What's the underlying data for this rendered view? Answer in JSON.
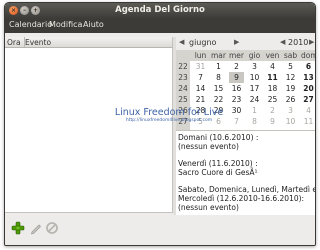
{
  "window": {
    "title": "Agenda Del Giorno"
  },
  "menu": {
    "items": [
      "Calendario",
      "Modifica",
      "Aiuto"
    ]
  },
  "event_list": {
    "columns": [
      "Ora",
      "Evento"
    ]
  },
  "calendar": {
    "month_label": "giugno",
    "year_label": "2010",
    "nav": {
      "prev": "◀",
      "next": "▶"
    },
    "weekdays": [
      "lun",
      "mar",
      "mer",
      "gio",
      "ven",
      "sab",
      "dom"
    ],
    "weeks": [
      {
        "num": "22",
        "days": [
          "31",
          "1",
          "2",
          "3",
          "4",
          "5",
          "6"
        ]
      },
      {
        "num": "23",
        "days": [
          "7",
          "8",
          "9",
          "10",
          "11",
          "12",
          "13"
        ]
      },
      {
        "num": "24",
        "days": [
          "14",
          "15",
          "16",
          "17",
          "18",
          "19",
          "20"
        ]
      },
      {
        "num": "25",
        "days": [
          "21",
          "22",
          "23",
          "24",
          "25",
          "26",
          "27"
        ]
      },
      {
        "num": "26",
        "days": [
          "28",
          "29",
          "30",
          "1",
          "2",
          "3",
          "4"
        ]
      },
      {
        "num": "27",
        "days": [
          "5",
          "6",
          "7",
          "8",
          "9",
          "10",
          "11"
        ]
      }
    ],
    "today": "9"
  },
  "details": {
    "entries": [
      "Domani (10.6.2010) :\n(nessun evento)",
      "Venerdì (11.6.2010) :\nSacro Cuore di GesÃ¹",
      "Sabato, Domenica, Lunedì, Martedì e\nMercoledì (12.6.2010-16.6.2010):\n(nessun evento)"
    ]
  },
  "watermark": {
    "title": "Linux Freedom for Live",
    "url": "http://linuxfreedom4live.blogspot.com"
  },
  "toolbar": {
    "icons": [
      "add-icon",
      "edit-icon",
      "delete-icon"
    ]
  },
  "colors": {
    "titlebar": "#3d3c38",
    "menubar": "#3c3b37",
    "add_green": "#4e9a06",
    "today_highlight": "#c9c7c2"
  }
}
